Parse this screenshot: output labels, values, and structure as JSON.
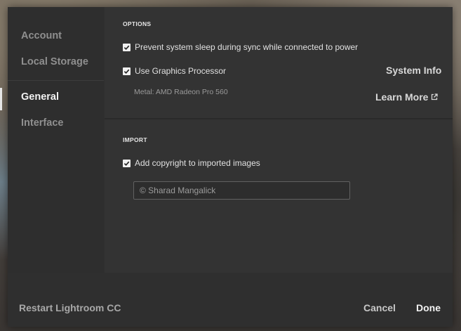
{
  "sidebar": {
    "items": [
      {
        "label": "Account"
      },
      {
        "label": "Local Storage"
      },
      {
        "label": "General"
      },
      {
        "label": "Interface"
      }
    ],
    "active": "General"
  },
  "options": {
    "title": "OPTIONS",
    "prevent_sleep": {
      "label": "Prevent system sleep during sync while connected to power",
      "checked": true
    },
    "gpu": {
      "label": "Use Graphics Processor",
      "checked": true
    },
    "gpu_info": "Metal: AMD Radeon Pro 560",
    "system_info_label": "System Info",
    "learn_more_label": "Learn More"
  },
  "import": {
    "title": "IMPORT",
    "copyright": {
      "label": "Add copyright to imported images",
      "checked": true
    },
    "copyright_value": "© Sharad Mangalick"
  },
  "footer": {
    "restart_label": "Restart Lightroom CC",
    "cancel_label": "Cancel",
    "done_label": "Done"
  },
  "colors": {
    "dialog_bg": "#2f2f2f",
    "panel_bg": "#333333",
    "text_active": "#f2f2f2",
    "text_muted": "#8f8f8f"
  }
}
